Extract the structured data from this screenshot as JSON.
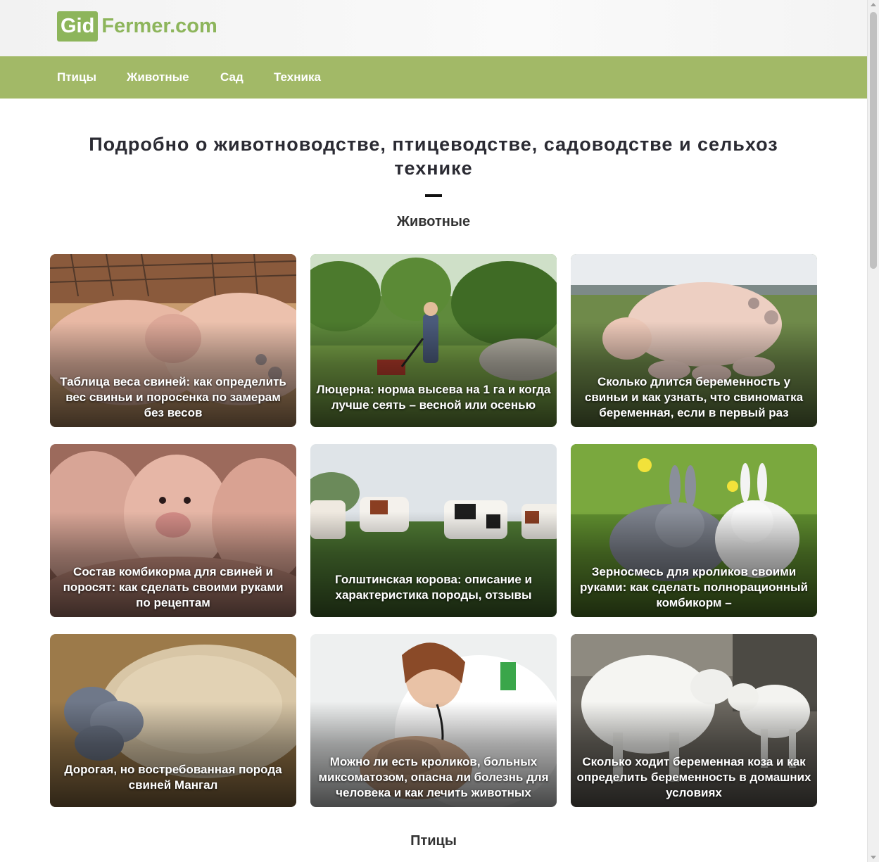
{
  "brand": {
    "prefix": "Gid",
    "name": "Fermer.com"
  },
  "nav": {
    "items": [
      {
        "label": "Птицы"
      },
      {
        "label": "Животные"
      },
      {
        "label": "Сад"
      },
      {
        "label": "Техника"
      }
    ]
  },
  "main": {
    "title": "Подробно о животноводстве, птицеводстве, садоводстве и сельхоз технике",
    "sections": [
      {
        "title": "Животные",
        "articles": [
          {
            "title": "Таблица веса свиней: как определить вес свиньи и поросенка по замерам без весов",
            "image": "pigs-sleeping-photo"
          },
          {
            "title": "Люцерна: норма высева на 1 га и когда лучше сеять – весной или осенью",
            "image": "woman-mowing-garden-photo"
          },
          {
            "title": "Сколько длится беременность у свиньи и как узнать, что свиноматка беременная, если в первый раз",
            "image": "sow-with-piglets-photo"
          },
          {
            "title": "Состав комбикорма для свиней и поросят: как сделать своими руками по рецептам",
            "image": "piglets-closeup-photo"
          },
          {
            "title": "Голштинская корова: описание и характеристика породы, отзывы",
            "image": "holstein-cows-photo"
          },
          {
            "title": "Зерносмесь для кроликов своими руками: как сделать полнорационный комбикорм –",
            "image": "rabbits-on-grass-photo"
          },
          {
            "title": "Дорогая, но востребованная порода свиней Мангал",
            "image": "mangalica-pig-photo"
          },
          {
            "title": "Можно ли есть кроликов, больных миксоматозом, опасна ли болезнь для человека и как лечить животных",
            "image": "vet-with-rabbit-photo"
          },
          {
            "title": "Сколько ходит беременная коза и как определить беременность в домашних условиях",
            "image": "goats-photo"
          }
        ]
      },
      {
        "title": "Птицы",
        "articles": []
      }
    ]
  },
  "colors": {
    "brand_green": "#8db55b",
    "nav_bar": "#a2b967",
    "text_dark": "#2b2b33"
  }
}
